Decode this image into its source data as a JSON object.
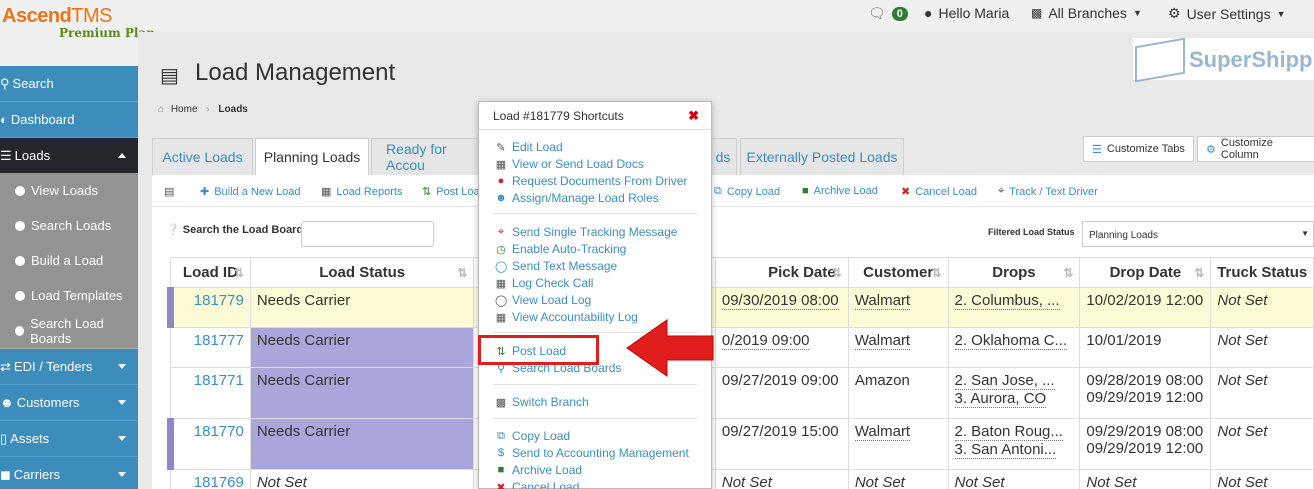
{
  "brand": {
    "name": "Ascend",
    "tms": "TMS",
    "plan": "Premium Plan"
  },
  "topbar": {
    "messages": "0",
    "user": "Hello Maria",
    "branches": "All Branches",
    "settings": "User Settings"
  },
  "sidebar": [
    {
      "label": "Search"
    },
    {
      "label": "Dashboard"
    },
    {
      "label": "Loads"
    },
    {
      "label": "View Loads"
    },
    {
      "label": "Search Loads"
    },
    {
      "label": "Build a Load"
    },
    {
      "label": "Load Templates"
    },
    {
      "label": "Search Load Boards"
    },
    {
      "label": "EDI / Tenders"
    },
    {
      "label": "Customers"
    },
    {
      "label": "Assets"
    },
    {
      "label": "Carriers"
    }
  ],
  "page": {
    "title": "Load Management",
    "crumb_home": "Home",
    "crumb_current": "Loads",
    "logo": "SuperShipp"
  },
  "tabs": [
    "Active Loads",
    "Planning Loads",
    "Ready for Accou",
    "ds",
    "Externally Posted Loads"
  ],
  "buttons": {
    "customize_tabs": "Customize Tabs",
    "customize_columns": "Customize Column"
  },
  "toolbar": [
    "Build a New Load",
    "Load Reports",
    "Post Loa",
    "Copy Load",
    "Archive Load",
    "Cancel Load",
    "Track / Text Driver"
  ],
  "search": {
    "label": "Search the Load Board",
    "filter_label": "Filtered Load Status",
    "filter_value": "Planning Loads"
  },
  "table": {
    "headers": [
      "Load ID",
      "Load Status",
      "",
      "Pick Date",
      "Customer",
      "Drops",
      "Drop Date",
      "Truck Status"
    ],
    "rows": [
      {
        "id": "181779",
        "status": "Needs Carrier",
        "pick": "09/30/2019 08:00",
        "customer": "Walmart",
        "drops": [
          "2. Columbus, ..."
        ],
        "drop_date": [
          "10/02/2019 12:00"
        ],
        "truck": "Not Set"
      },
      {
        "id": "181777",
        "status": "Needs Carrier",
        "pick": "0/2019 09:00",
        "customer": "Walmart",
        "drops": [
          "2. Oklahoma C..."
        ],
        "drop_date": [
          "10/01/2019"
        ],
        "truck": "Not Set"
      },
      {
        "id": "181771",
        "status": "Needs Carrier",
        "pick": "09/27/2019 09:00",
        "customer": "Amazon",
        "drops": [
          "2. San Jose, ...",
          "3. Aurora, CO"
        ],
        "drop_date": [
          "09/28/2019 08:00",
          "09/29/2019 12:00"
        ],
        "truck": "Not Set"
      },
      {
        "id": "181770",
        "status": "Needs Carrier",
        "pick": "09/27/2019 15:00",
        "customer": "Walmart",
        "drops": [
          "2. Baton Roug...",
          "3. San Antoni..."
        ],
        "drop_date": [
          "09/29/2019 08:00",
          "09/29/2019 12:00"
        ],
        "truck": "Not Set"
      },
      {
        "id": "181769",
        "status": "Not Set",
        "pick": "Not Set",
        "customer": "Not Set",
        "drops": [
          "Not Set"
        ],
        "drop_date": [
          "Not Set"
        ],
        "truck": "Not Set"
      }
    ]
  },
  "popup": {
    "title": "Load #181779 Shortcuts",
    "items": [
      "Edit Load",
      "View or Send Load Docs",
      "Request Documents From Driver",
      "Assign/Manage Load Roles",
      "Send Single Tracking Message",
      "Enable Auto-Tracking",
      "Send Text Message",
      "Log Check Call",
      "View Load Log",
      "View Accountability Log",
      "Post Load",
      "Search Load Boards",
      "Switch Branch",
      "Copy Load",
      "Send to Accounting Management",
      "Archive Load",
      "Cancel Load"
    ]
  },
  "colors": {
    "accent": "#3c8dbc",
    "highlight": "#e01e1e",
    "status_bg": "#a9a6dc"
  }
}
